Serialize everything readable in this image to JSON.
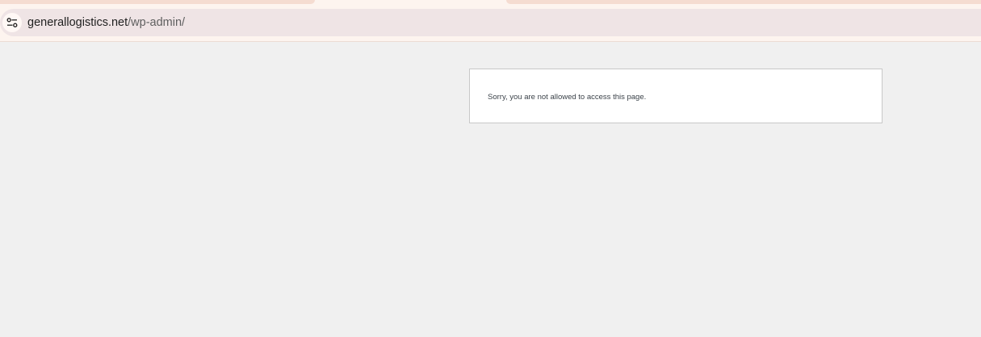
{
  "address_bar": {
    "icon": "tune-icon",
    "domain": "generallogistics.net",
    "path": "/wp-admin/"
  },
  "page": {
    "message": "Sorry, you are not allowed to access this page."
  },
  "colors": {
    "page_background": "#f0f0f0",
    "chrome_background": "#fdf4ef",
    "omnibox_background": "#efe4e5",
    "tab_accent": "#f5dcd1"
  }
}
